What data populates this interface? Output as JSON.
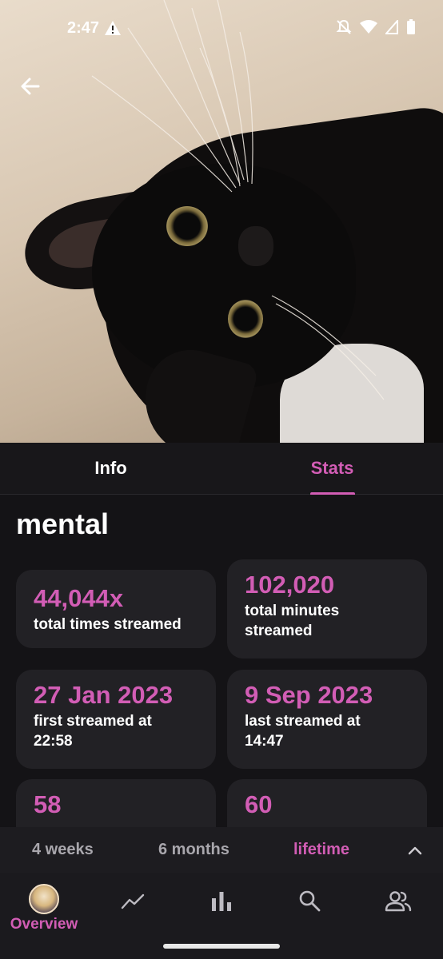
{
  "status_bar": {
    "time": "2:47"
  },
  "tabs": [
    {
      "label": "Info",
      "active": false
    },
    {
      "label": "Stats",
      "active": true
    }
  ],
  "song": {
    "title": "mental"
  },
  "stats": [
    {
      "value": "44,044x",
      "label": "total times streamed"
    },
    {
      "value": "102,020",
      "label": "total minutes streamed"
    },
    {
      "value": "27 Jan 2023",
      "label": "first streamed at 22:58"
    },
    {
      "value": "9 Sep 2023",
      "label": "last streamed at 14:47"
    },
    {
      "value": "58",
      "label": ""
    },
    {
      "value": "60",
      "label": ""
    }
  ],
  "range": {
    "options": [
      "4 weeks",
      "6 months",
      "lifetime"
    ],
    "selected": "lifetime"
  },
  "bottom_nav": {
    "items": [
      {
        "name": "overview",
        "label": "Overview",
        "icon": "avatar"
      },
      {
        "name": "trends",
        "label": "",
        "icon": "trend-line-icon"
      },
      {
        "name": "charts",
        "label": "",
        "icon": "bar-chart-icon"
      },
      {
        "name": "search",
        "label": "",
        "icon": "search-icon"
      },
      {
        "name": "friends",
        "label": "",
        "icon": "people-icon"
      }
    ]
  },
  "colors": {
    "accent": "#d25db5",
    "background": "#141316",
    "card": "#222125"
  }
}
